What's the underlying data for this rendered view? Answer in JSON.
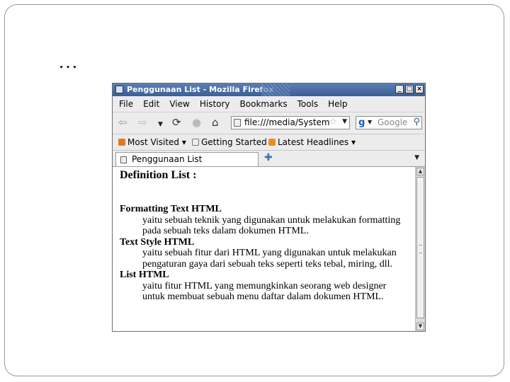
{
  "slide": {
    "title": "…"
  },
  "window": {
    "title": "Penggunaan List - Mozilla Firefox",
    "controls": {
      "minimize": "_",
      "maximize": "□",
      "close": "×"
    }
  },
  "menu": [
    "File",
    "Edit",
    "View",
    "History",
    "Bookmarks",
    "Tools",
    "Help"
  ],
  "navigation": {
    "url": "file:///media/System",
    "search_placeholder": "Google",
    "icons": [
      "back-icon",
      "forward-icon",
      "history-dropdown-icon",
      "reload-icon",
      "stop-icon",
      "home-icon",
      "bookmark-star-icon",
      "search-icon"
    ]
  },
  "bookmarks": {
    "most_visited": "Most Visited",
    "getting_started": "Getting Started",
    "latest_headlines": "Latest Headlines"
  },
  "tab": {
    "label": "Penggunaan List"
  },
  "page": {
    "heading": "Definition List :",
    "items": [
      {
        "term": "Formatting Text HTML",
        "definition": "yaitu sebuah teknik yang digunakan untuk melakukan formatting pada sebuah teks dalam dokumen HTML."
      },
      {
        "term": "Text Style HTML",
        "definition": "yaitu sebuah fitur dari HTML yang digunakan untuk melakukan pengaturan gaya dari sebuah teks seperti teks tebal, miring, dll."
      },
      {
        "term": "List HTML",
        "definition": "yaitu fitur HTML yang memungkinkan seorang web designer untuk membuat sebuah menu daftar dalam dokumen HTML."
      }
    ]
  },
  "colors": {
    "titlebar": "#3b5f96",
    "chrome": "#ececec",
    "content_bg": "#ffffff"
  }
}
